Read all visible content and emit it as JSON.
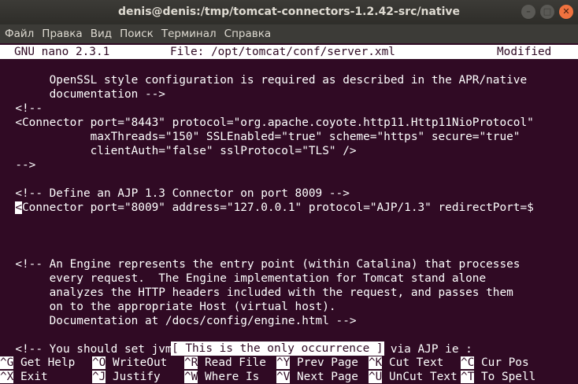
{
  "window": {
    "title": "denis@denis:/tmp/tomcat-connectors-1.2.42-src/native"
  },
  "menu": [
    "Файл",
    "Правка",
    "Вид",
    "Поиск",
    "Терминал",
    "Справка"
  ],
  "nano": {
    "version": "GNU nano 2.3.1",
    "file": "File: /opt/tomcat/conf/server.xml",
    "state": "Modified"
  },
  "lines": [
    "",
    "       OpenSSL style configuration is required as described in the APR/native",
    "       documentation -->",
    "  <!--",
    "  <Connector port=\"8443\" protocol=\"org.apache.coyote.http11.Http11NioProtocol\"",
    "             maxThreads=\"150\" SSLEnabled=\"true\" scheme=\"https\" secure=\"true\"",
    "             clientAuth=\"false\" sslProtocol=\"TLS\" />",
    "  -->",
    "",
    "  <!-- Define an AJP 1.3 Connector on port 8009 -->",
    "",
    "",
    "",
    "",
    "  <!-- An Engine represents the entry point (within Catalina) that processes",
    "       every request.  The Engine implementation for Tomcat stand alone",
    "       analyzes the HTTP headers included with the request, and passes them",
    "       on to the appropriate Host (virtual host).",
    "       Documentation at /docs/config/engine.html -->",
    "",
    "  <!-- You should set jvmRoute to support load-balancing via AJP ie :"
  ],
  "cursor_line": {
    "indent": "  ",
    "cursor_char": "<",
    "rest": "Connector port=\"8009\" address=\"127.0.0.1\" protocol=\"AJP/1.3\" redirectPort=$"
  },
  "status_message": "[ This is the only occurrence ]",
  "shortcuts_row1": [
    {
      "key": "^G",
      "label": " Get Help"
    },
    {
      "key": "^O",
      "label": " WriteOut"
    },
    {
      "key": "^R",
      "label": " Read File"
    },
    {
      "key": "^Y",
      "label": " Prev Page"
    },
    {
      "key": "^K",
      "label": " Cut Text"
    },
    {
      "key": "^C",
      "label": " Cur Pos"
    }
  ],
  "shortcuts_row2": [
    {
      "key": "^X",
      "label": " Exit"
    },
    {
      "key": "^J",
      "label": " Justify"
    },
    {
      "key": "^W",
      "label": " Where Is"
    },
    {
      "key": "^V",
      "label": " Next Page"
    },
    {
      "key": "^U",
      "label": " UnCut Text"
    },
    {
      "key": "^T",
      "label": " To Spell"
    }
  ],
  "colors": {
    "terminal_bg": "#300a24",
    "terminal_fg": "#ffffff",
    "titlebar_bg": "#3c3b37",
    "close_button": "#f0723f"
  }
}
